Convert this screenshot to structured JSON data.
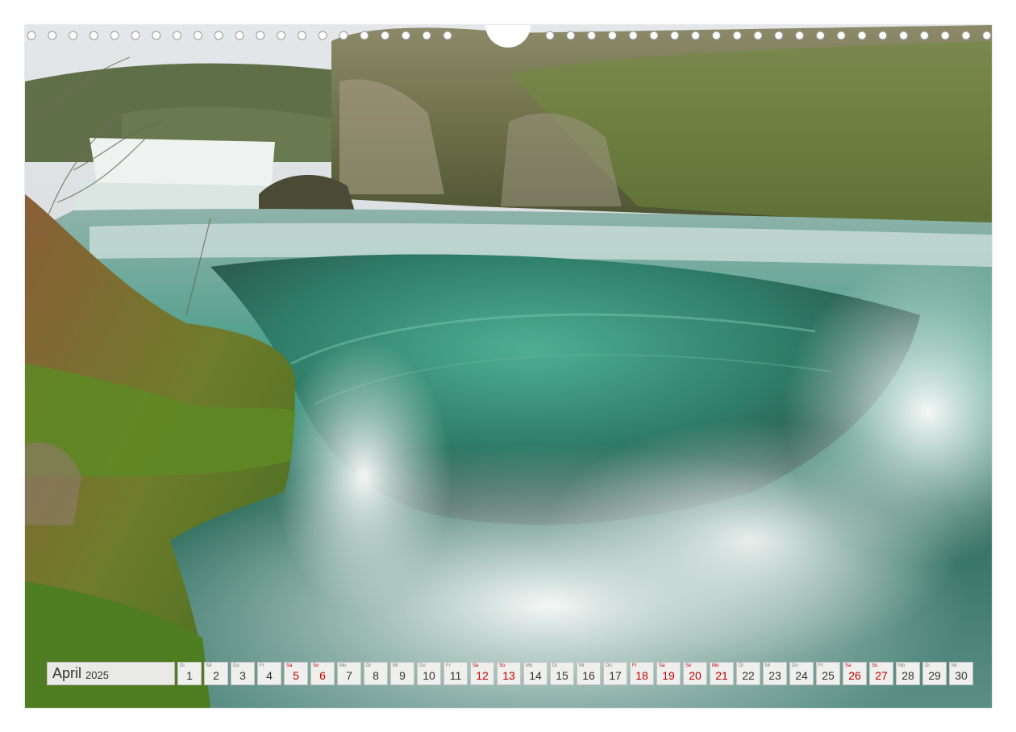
{
  "calendar": {
    "month": "April",
    "year": "2025",
    "weekend_color": "#c00000",
    "text_color": "#333333",
    "days": [
      {
        "wd": "Di",
        "n": "1",
        "we": false
      },
      {
        "wd": "Mi",
        "n": "2",
        "we": false
      },
      {
        "wd": "Do",
        "n": "3",
        "we": false
      },
      {
        "wd": "Fr",
        "n": "4",
        "we": false
      },
      {
        "wd": "Sa",
        "n": "5",
        "we": true
      },
      {
        "wd": "So",
        "n": "6",
        "we": true
      },
      {
        "wd": "Mo",
        "n": "7",
        "we": false
      },
      {
        "wd": "Di",
        "n": "8",
        "we": false
      },
      {
        "wd": "Mi",
        "n": "9",
        "we": false
      },
      {
        "wd": "Do",
        "n": "10",
        "we": false
      },
      {
        "wd": "Fr",
        "n": "11",
        "we": false
      },
      {
        "wd": "Sa",
        "n": "12",
        "we": true
      },
      {
        "wd": "So",
        "n": "13",
        "we": true
      },
      {
        "wd": "Mo",
        "n": "14",
        "we": false
      },
      {
        "wd": "Di",
        "n": "15",
        "we": false
      },
      {
        "wd": "Mi",
        "n": "16",
        "we": false
      },
      {
        "wd": "Do",
        "n": "17",
        "we": false
      },
      {
        "wd": "Fr",
        "n": "18",
        "we": true
      },
      {
        "wd": "Sa",
        "n": "19",
        "we": true
      },
      {
        "wd": "So",
        "n": "20",
        "we": true
      },
      {
        "wd": "Mo",
        "n": "21",
        "we": true
      },
      {
        "wd": "Di",
        "n": "22",
        "we": false
      },
      {
        "wd": "Mi",
        "n": "23",
        "we": false
      },
      {
        "wd": "Do",
        "n": "24",
        "we": false
      },
      {
        "wd": "Fr",
        "n": "25",
        "we": false
      },
      {
        "wd": "Sa",
        "n": "26",
        "we": true
      },
      {
        "wd": "So",
        "n": "27",
        "we": true
      },
      {
        "wd": "Mo",
        "n": "28",
        "we": false
      },
      {
        "wd": "Di",
        "n": "29",
        "we": false
      },
      {
        "wd": "Mi",
        "n": "30",
        "we": false
      }
    ]
  },
  "photo": {
    "subject": "waterfall-river-photo",
    "colors": {
      "water": "#3d9a82",
      "foam": "#e8eeec",
      "moss": "#5f8a2c",
      "rock": "#7a6a52",
      "sky": "#dfe3e6"
    }
  }
}
